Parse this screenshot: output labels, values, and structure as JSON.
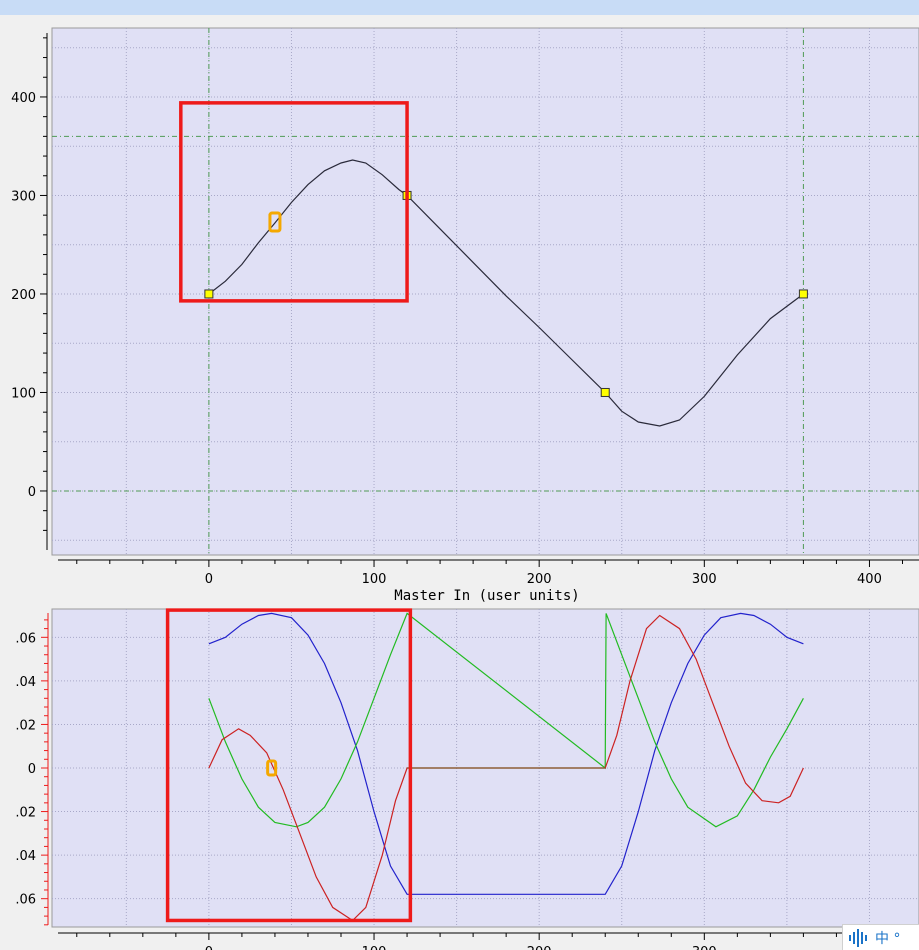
{
  "colors": {
    "plot_background": "#e0e0f5",
    "grid": "#a8a8c8",
    "origin_line": "#4f9a55",
    "curve_position": "#2a2a3a",
    "curve_blue": "#2222cc",
    "curve_green": "#22bb22",
    "curve_red": "#cc2222",
    "curve_flat": "#806030",
    "highlight_box": "#ee1a1a",
    "cursor_marker": "#f4a800",
    "point_fill": "#ffff00"
  },
  "icons": {
    "ime_voice": "voice-bars-icon",
    "ime_lang": "chinese-input-icon"
  },
  "ime": {
    "label": "中 °"
  },
  "chart_data": [
    {
      "type": "line",
      "xlabel": "Master In (user units)",
      "xlim": [
        -95,
        430
      ],
      "ylim": [
        -65,
        470
      ],
      "xticks": [
        0,
        100,
        200,
        300,
        400
      ],
      "yticks": [
        0,
        100,
        200,
        300,
        400
      ],
      "xtick_labels": [
        "0",
        "100",
        "200",
        "300",
        "400"
      ],
      "ytick_labels": [
        "0",
        "100",
        "200",
        "300",
        "400"
      ],
      "control_points": [
        {
          "x": 0,
          "y": 200
        },
        {
          "x": 120,
          "y": 300
        },
        {
          "x": 240,
          "y": 100
        },
        {
          "x": 360,
          "y": 200
        }
      ],
      "series": [
        {
          "x": [
            0,
            10,
            20,
            30,
            40,
            50,
            60,
            70,
            80,
            87,
            95,
            105,
            115,
            120,
            140,
            160,
            180,
            200,
            220,
            240,
            250,
            260,
            273,
            285,
            300,
            320,
            340,
            360
          ],
          "y": [
            200,
            213,
            230,
            252,
            272,
            293,
            311,
            325,
            333,
            336,
            333,
            321,
            306,
            300,
            266,
            232,
            198,
            166,
            133,
            100,
            81,
            70,
            66,
            72,
            96,
            138,
            175,
            200
          ]
        }
      ],
      "reference_lines": {
        "vertical": [
          0,
          360
        ],
        "horizontal": [
          0,
          360
        ]
      },
      "highlight": {
        "x": [
          -17,
          120
        ],
        "y": [
          193,
          394
        ]
      },
      "cursor": {
        "x": 40,
        "y": 273
      }
    },
    {
      "type": "line",
      "xlim": [
        -95,
        430
      ],
      "ylim": [
        -0.073,
        0.073
      ],
      "xticks": [
        0,
        100,
        200,
        300
      ],
      "yticks": [
        -0.06,
        -0.04,
        -0.02,
        0,
        0.02,
        0.04,
        0.06
      ],
      "xtick_labels": [
        "0",
        "100",
        "200",
        "300"
      ],
      "ytick_labels": [
        ".06",
        ".04",
        ".02",
        "0",
        ".02",
        ".04",
        ".06"
      ],
      "series": [
        {
          "color_key": "curve_blue",
          "x": [
            0,
            10,
            20,
            30,
            38,
            50,
            60,
            70,
            80,
            90,
            100,
            110,
            120,
            240,
            250,
            260,
            270,
            280,
            290,
            300,
            310,
            322,
            330,
            340,
            350,
            360
          ],
          "y": [
            0.057,
            0.06,
            0.066,
            0.07,
            0.071,
            0.069,
            0.061,
            0.048,
            0.03,
            0.008,
            -0.02,
            -0.045,
            -0.058,
            -0.058,
            -0.045,
            -0.02,
            0.008,
            0.03,
            0.048,
            0.061,
            0.069,
            0.071,
            0.07,
            0.066,
            0.06,
            0.057
          ]
        },
        {
          "color_key": "curve_green",
          "x": [
            0,
            10,
            20,
            30,
            40,
            53,
            60,
            70,
            80,
            90,
            100,
            110,
            120,
            240,
            240.5,
            250,
            260,
            270,
            280,
            290,
            307,
            320,
            330,
            340,
            350,
            360
          ],
          "y": [
            0.032,
            0.012,
            -0.005,
            -0.018,
            -0.025,
            -0.027,
            -0.025,
            -0.018,
            -0.005,
            0.012,
            0.032,
            0.052,
            0.071,
            0,
            0.071,
            0.052,
            0.032,
            0.012,
            -0.005,
            -0.018,
            -0.027,
            -0.022,
            -0.01,
            0.005,
            0.018,
            0.032
          ]
        },
        {
          "color_key": "curve_red",
          "x": [
            0,
            8,
            18,
            25,
            35,
            45,
            55,
            65,
            75,
            87,
            95,
            105,
            113,
            120,
            240,
            247,
            255,
            265,
            273,
            285,
            295,
            305,
            315,
            325,
            335,
            345,
            352,
            360
          ],
          "y": [
            0,
            0.013,
            0.018,
            0.015,
            0.007,
            -0.01,
            -0.03,
            -0.05,
            -0.064,
            -0.07,
            -0.064,
            -0.04,
            -0.015,
            0,
            0,
            0.015,
            0.04,
            0.064,
            0.07,
            0.064,
            0.05,
            0.03,
            0.01,
            -0.007,
            -0.015,
            -0.016,
            -0.013,
            0
          ]
        },
        {
          "color_key": "curve_flat",
          "x": [
            120,
            240
          ],
          "y": [
            0,
            0
          ]
        }
      ],
      "highlight": {
        "x": [
          -25,
          122
        ],
        "y": [
          -0.07,
          0.0725
        ]
      },
      "cursor": {
        "x": 38,
        "y": 0
      }
    }
  ]
}
